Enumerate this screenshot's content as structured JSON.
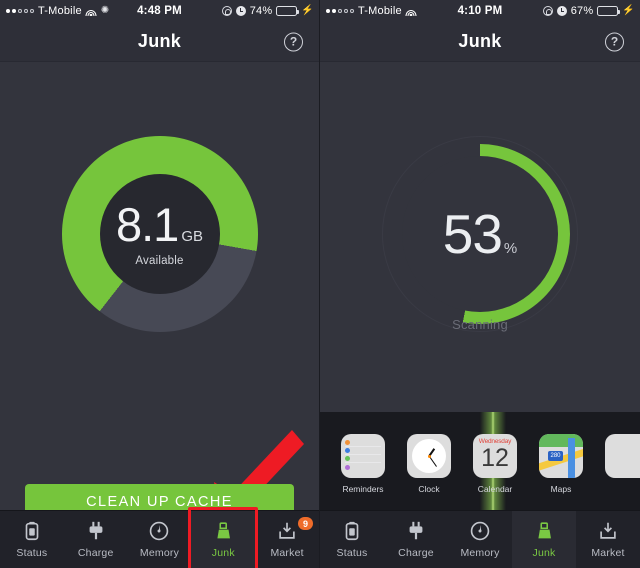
{
  "screens": [
    {
      "id": "left",
      "status_bar": {
        "signal_filled": 2,
        "signal_hollow": 3,
        "carrier": "T-Mobile",
        "wifi_icon": "wifi-icon",
        "extra_icon": "sun-icon",
        "time": "4:48 PM",
        "lock_icon": "rotation-lock-icon",
        "alarm_icon": "alarm-clock-icon",
        "battery_percent": "74%",
        "battery_level": 74,
        "charging_icon": "bolt-icon"
      },
      "nav": {
        "title": "Junk",
        "help_icon": "help-question-icon"
      },
      "gauge": {
        "type": "donut",
        "value_text": "8.1",
        "unit_text": "GB",
        "caption": "Available",
        "used_percent": 28,
        "free_percent": 72
      },
      "cta": {
        "label": "CLEAN UP CACHE"
      },
      "annotation": {
        "arrow": "red-arrow-pointing-to-clean-up-cache"
      },
      "highlight": {
        "target": "Junk"
      },
      "tabs": [
        {
          "label": "Status",
          "icon": "battery-status-icon",
          "active": false,
          "badge": null
        },
        {
          "label": "Charge",
          "icon": "plug-charge-icon",
          "active": false,
          "badge": null
        },
        {
          "label": "Memory",
          "icon": "gauge-memory-icon",
          "active": false,
          "badge": null
        },
        {
          "label": "Junk",
          "icon": "broom-junk-icon",
          "active": true,
          "badge": null
        },
        {
          "label": "Market",
          "icon": "market-download-icon",
          "active": false,
          "badge": "9"
        }
      ]
    },
    {
      "id": "right",
      "status_bar": {
        "signal_filled": 2,
        "signal_hollow": 3,
        "carrier": "T-Mobile",
        "wifi_icon": "wifi-icon",
        "extra_icon": null,
        "time": "4:10 PM",
        "lock_icon": "rotation-lock-icon",
        "alarm_icon": "alarm-clock-icon",
        "battery_percent": "67%",
        "battery_level": 67,
        "charging_icon": "bolt-icon"
      },
      "nav": {
        "title": "Junk",
        "help_icon": "help-question-icon"
      },
      "gauge": {
        "type": "ring",
        "value_text": "53",
        "unit_text": "%",
        "caption": "Scanning",
        "progress_percent": 53
      },
      "app_strip": [
        {
          "label": "Reminders",
          "icon": "reminders-app-icon"
        },
        {
          "label": "Clock",
          "icon": "clock-app-icon"
        },
        {
          "label": "Calendar",
          "icon": "calendar-app-icon",
          "day_of_week": "Wednesday",
          "day": "12"
        },
        {
          "label": "Maps",
          "icon": "maps-app-icon",
          "shield_text": "280"
        },
        {
          "label": "",
          "icon": "partial-app-icon"
        }
      ],
      "tabs": [
        {
          "label": "Status",
          "icon": "battery-status-icon",
          "active": false,
          "badge": null
        },
        {
          "label": "Charge",
          "icon": "plug-charge-icon",
          "active": false,
          "badge": null
        },
        {
          "label": "Memory",
          "icon": "gauge-memory-icon",
          "active": false,
          "badge": null
        },
        {
          "label": "Junk",
          "icon": "broom-junk-icon",
          "active": true,
          "badge": null
        },
        {
          "label": "Market",
          "icon": "market-download-icon",
          "active": false,
          "badge": null
        }
      ]
    }
  ],
  "colors": {
    "background": "#33343d",
    "bar": "#2e2f38",
    "accent_green": "#76c53c",
    "donut_used": "#474955",
    "tabbar": "#212229",
    "badge": "#ef6c2a",
    "annotation_red": "#ee1b24",
    "battery_green": "#4cd964"
  }
}
